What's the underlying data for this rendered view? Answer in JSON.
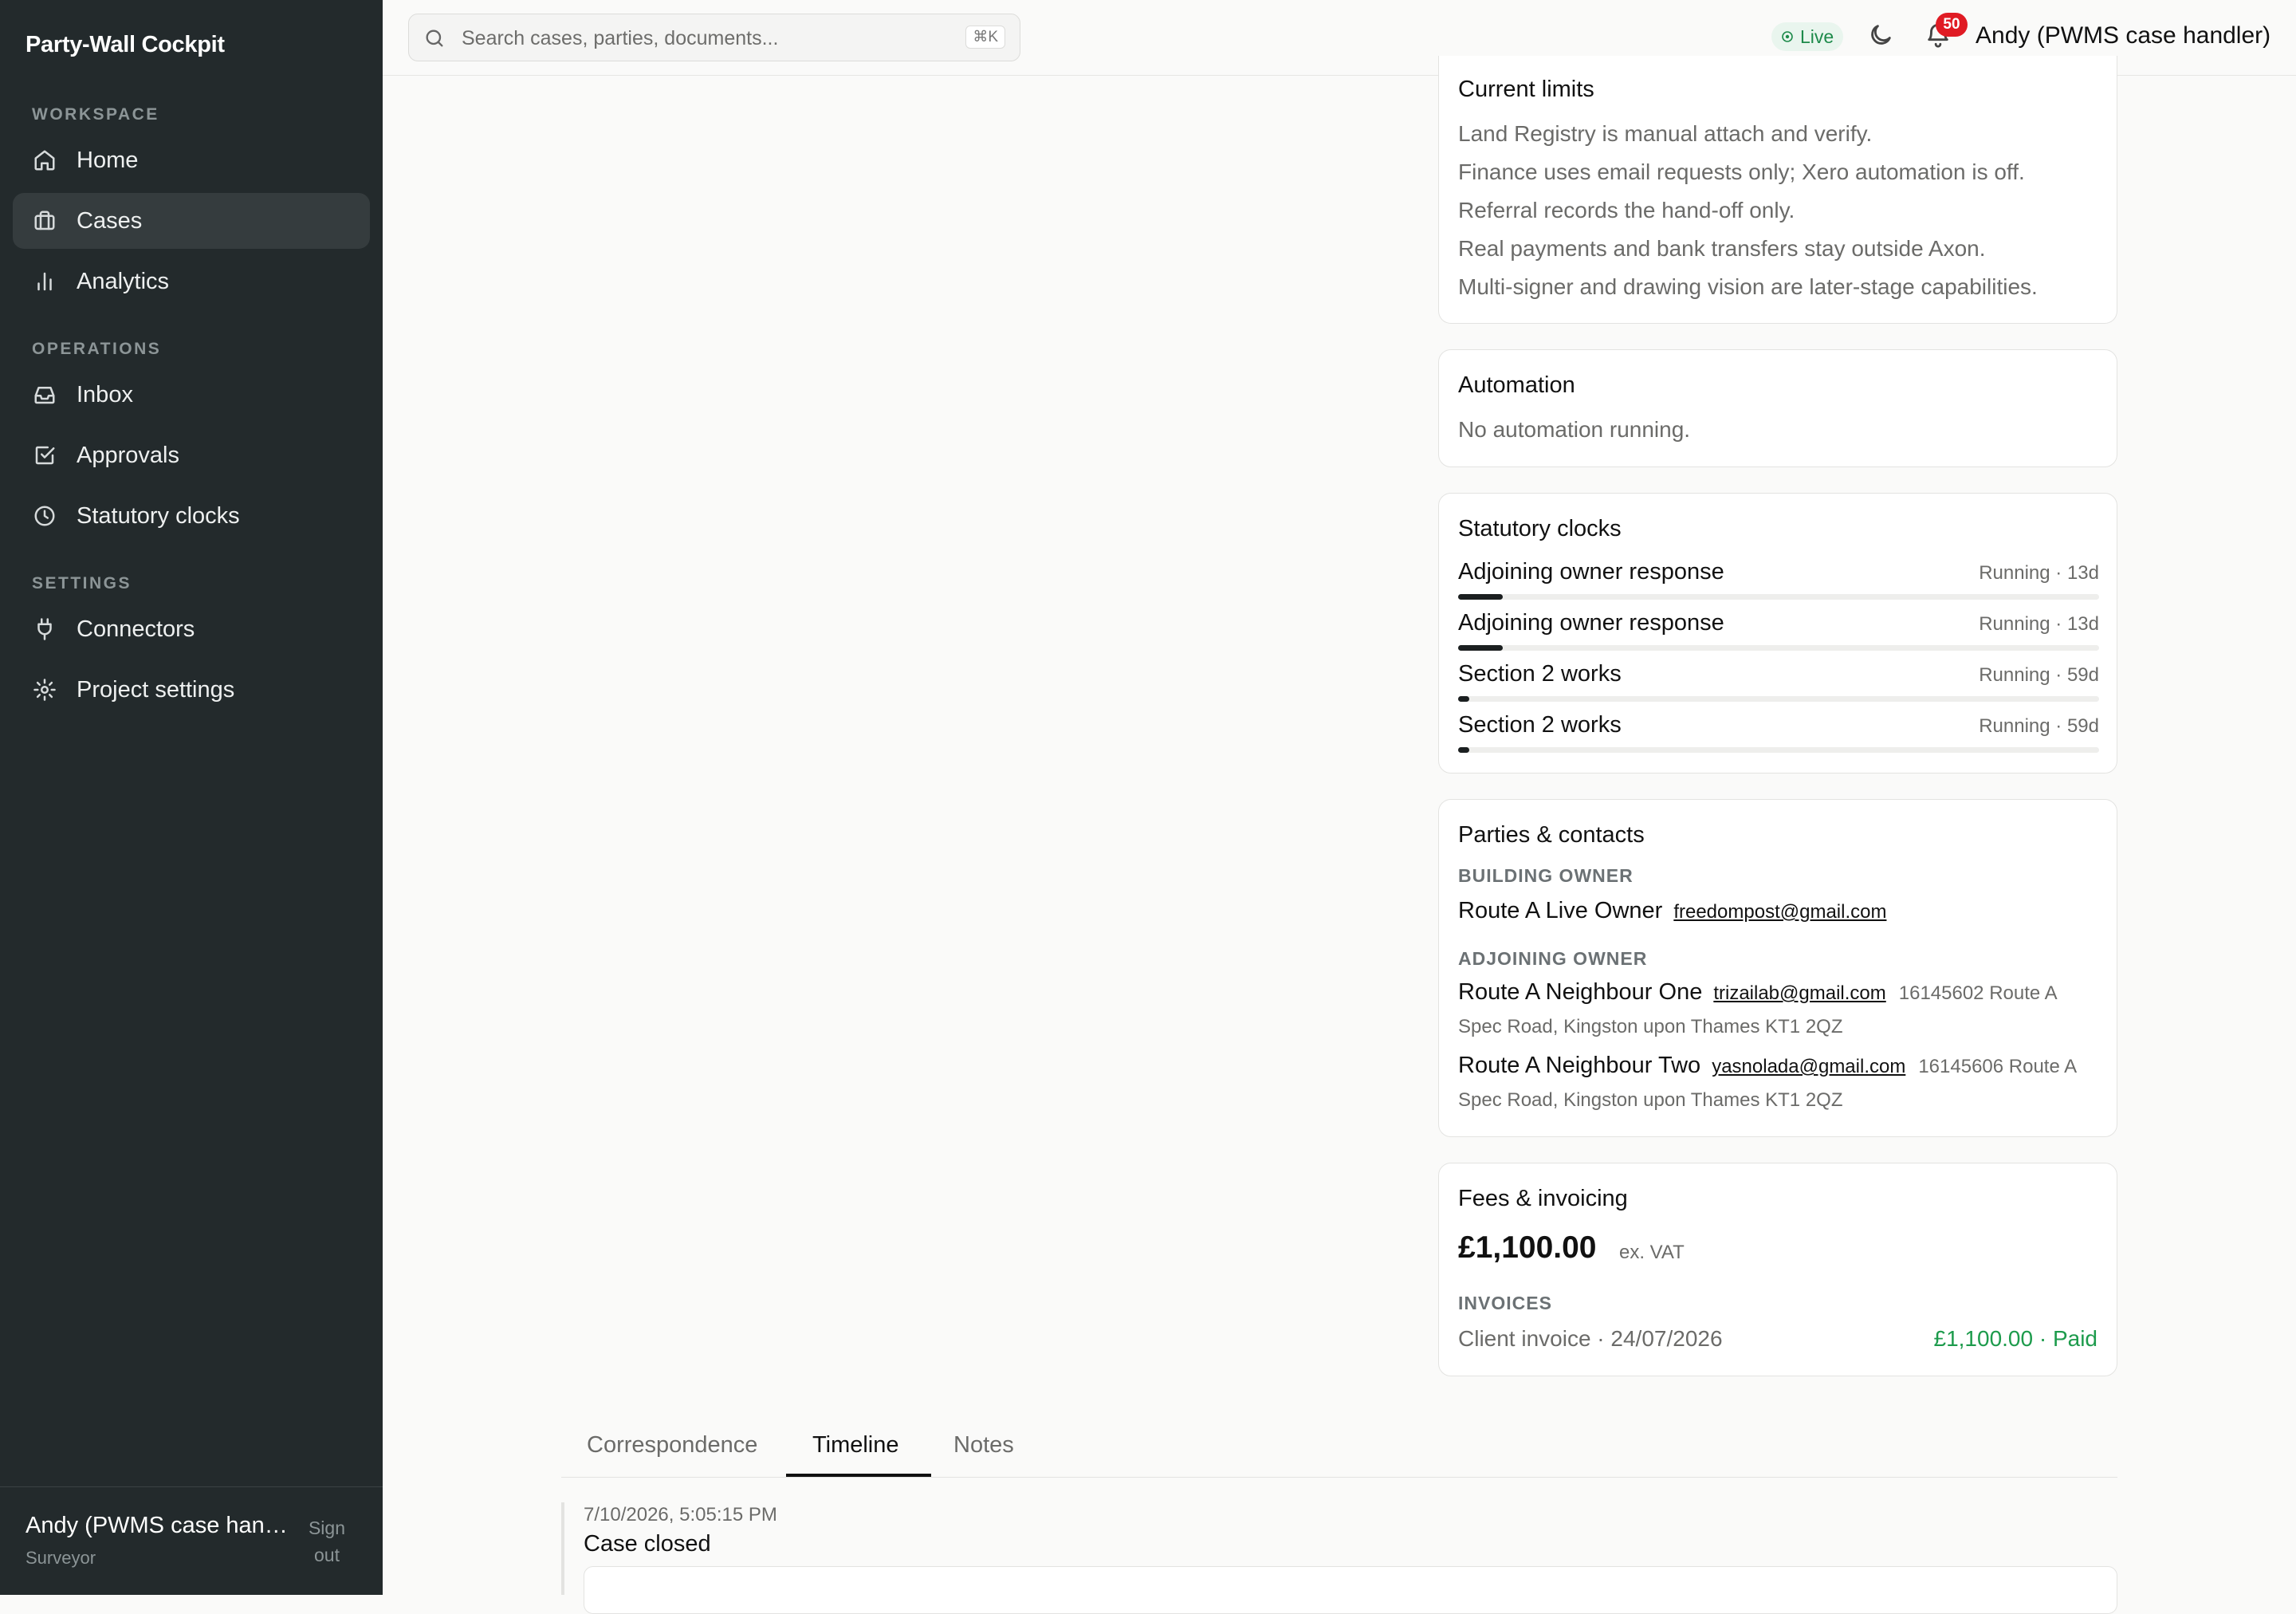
{
  "sidebar": {
    "brand": "Party-Wall Cockpit",
    "sections": {
      "workspace": "WORKSPACE",
      "operations": "OPERATIONS",
      "settings": "SETTINGS"
    },
    "items": {
      "home": "Home",
      "cases": "Cases",
      "analytics": "Analytics",
      "inbox": "Inbox",
      "approvals": "Approvals",
      "clocks": "Statutory clocks",
      "connectors": "Connectors",
      "project_settings": "Project settings"
    },
    "active_item": "cases",
    "footer": {
      "user_name": "Andy (PWMS case handler)",
      "user_role": "Surveyor",
      "sign_out": "Sign out"
    }
  },
  "topbar": {
    "search_placeholder": "Search cases, parties, documents...",
    "search_shortcut": "⌘K",
    "live_label": "Live",
    "notification_count": "50",
    "user_label": "Andy (PWMS case handler)"
  },
  "limits": {
    "title": "Current limits",
    "lines": [
      "Land Registry is manual attach and verify.",
      "Finance uses email requests only; Xero automation is off.",
      "Referral records the hand-off only.",
      "Real payments and bank transfers stay outside Axon.",
      "Multi-signer and drawing vision are later-stage capabilities."
    ]
  },
  "automation": {
    "title": "Automation",
    "status": "No automation running."
  },
  "clocks": {
    "title": "Statutory clocks",
    "items": [
      {
        "label": "Adjoining owner response",
        "status": "Running · 13d",
        "progress": 0.07
      },
      {
        "label": "Adjoining owner response",
        "status": "Running · 13d",
        "progress": 0.07
      },
      {
        "label": "Section 2 works",
        "status": "Running · 59d",
        "progress": 0.015
      },
      {
        "label": "Section 2 works",
        "status": "Running · 59d",
        "progress": 0.015
      }
    ]
  },
  "parties": {
    "title": "Parties & contacts",
    "building_owner_label": "BUILDING OWNER",
    "adjoining_owner_label": "ADJOINING OWNER",
    "building_owner": {
      "name": "Route A Live Owner",
      "email": "freedompost@gmail.com"
    },
    "adjoining_owners": [
      {
        "name": "Route A Neighbour One",
        "email": "trizailab@gmail.com",
        "address": "16145602 Route A Spec Road, Kingston upon Thames KT1 2QZ"
      },
      {
        "name": "Route A Neighbour Two",
        "email": "yasnolada@gmail.com",
        "address": "16145606 Route A Spec Road, Kingston upon Thames KT1 2QZ"
      }
    ]
  },
  "fees": {
    "title": "Fees & invoicing",
    "amount": "£1,100.00",
    "vat_note": "ex. VAT",
    "invoices_label": "INVOICES",
    "invoice_desc": "Client invoice · 24/07/2026",
    "invoice_status": "£1,100.00 · Paid"
  },
  "tabs": {
    "correspondence": "Correspondence",
    "timeline": "Timeline",
    "notes": "Notes",
    "active": "timeline"
  },
  "timeline": {
    "entries": [
      {
        "timestamp": "7/10/2026, 5:05:15 PM",
        "title": "Case closed"
      }
    ]
  },
  "colors": {
    "sidebar_bg": "#232a2c",
    "live_green": "#1d8a4a",
    "paid_green": "#1d9b4c",
    "badge_red": "#e01b24"
  }
}
